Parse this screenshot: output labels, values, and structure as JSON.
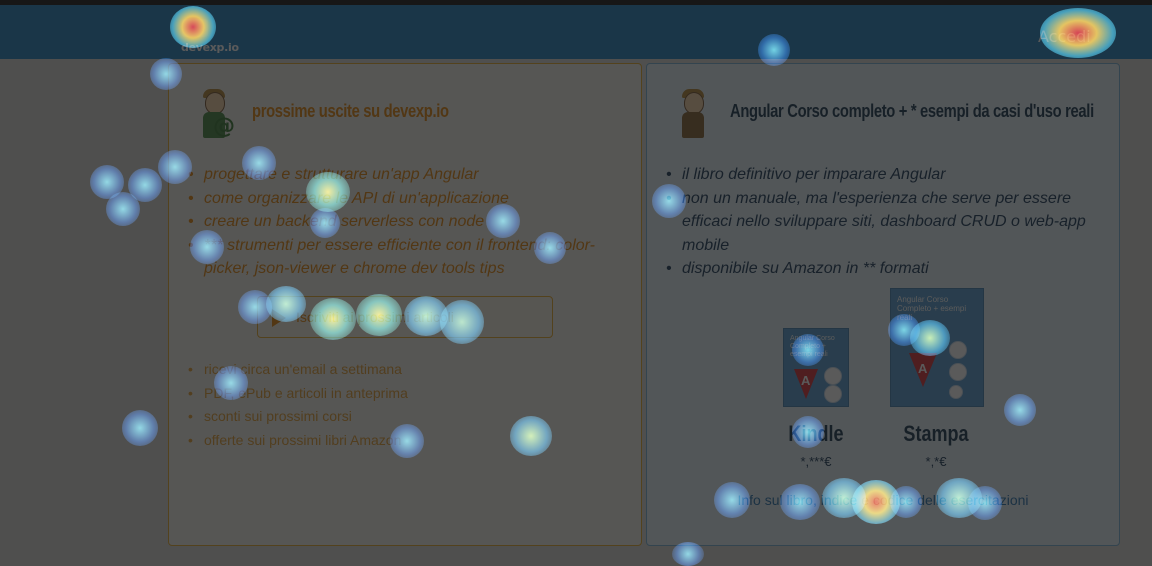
{
  "header": {
    "logo_text": "devexp.io",
    "login_label": "Accedi"
  },
  "left_card": {
    "title": "prossime uscite su devexp.io",
    "features": [
      "progettare e strutturare un'app Angular",
      "come organizzare le API di un'applicazione",
      "creare un backend serverless con node",
      "*** strumenti per essere efficiente con il frontend: color-picker, json-viewer e chrome dev tools tips"
    ],
    "cta_label": "Iscriviti ai prossimi articoli",
    "benefits": [
      "ricevi circa un'email a settimana",
      "PDF, ePub e articoli in anteprima",
      "sconti sui prossimi corsi",
      "offerte sui prossimi libri Amazon"
    ]
  },
  "right_card": {
    "title": "Angular Corso completo + * esempi da casi d'uso reali",
    "features": [
      "il libro definitivo per imparare Angular",
      "non un manuale, ma l'esperienza che serve per essere efficaci nello sviluppare siti, dashboard CRUD o web-app mobile",
      "disponibile su Amazon in ** formati"
    ],
    "book_cover_title": "Angular Corso Completo + esempi reali",
    "kindle": {
      "label": "Kindle",
      "price": "*,***€"
    },
    "print": {
      "label": "Stampa",
      "price": "*,*€"
    },
    "info_link": "Info sul libro, indice e codice delle esercitazioni"
  },
  "colors": {
    "header": "#2a86c2",
    "accent_orange": "#e38a16",
    "navy": "#1f3c56",
    "link_blue": "#2f78b3"
  }
}
